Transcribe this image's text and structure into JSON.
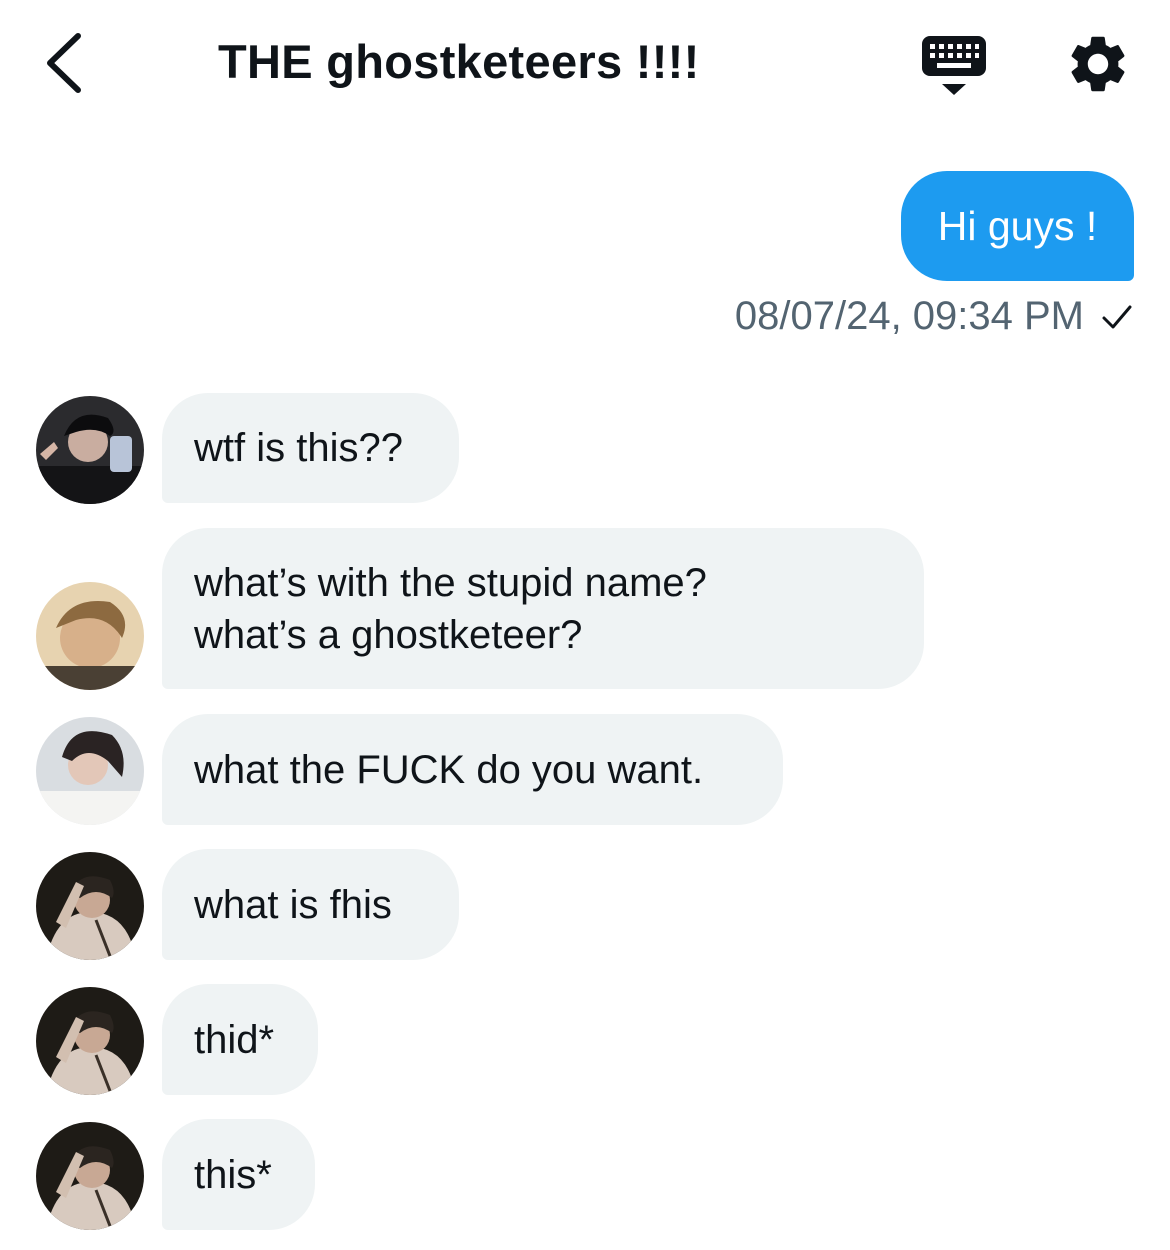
{
  "header": {
    "title": "THE ghostketeers !!!!",
    "back_icon": "chevron-left-icon",
    "keyboard_icon": "keyboard-icon",
    "settings_icon": "gear-icon"
  },
  "colors": {
    "accent": "#1d9bf0",
    "incoming_bubble": "#eff3f4",
    "muted_text": "#536471",
    "text": "#0f1419"
  },
  "outgoing": {
    "text": "Hi guys !",
    "timestamp": "08/07/24, 09:34 PM",
    "status_icon": "checkmark-icon"
  },
  "messages": [
    {
      "text": "wtf is this??"
    },
    {
      "text": "what’s with the stupid name?\nwhat’s a ghostketeer?"
    },
    {
      "text": "what the FUCK do you want."
    },
    {
      "text": "what is fhis"
    },
    {
      "text": "thid*"
    },
    {
      "text": "this*"
    }
  ]
}
